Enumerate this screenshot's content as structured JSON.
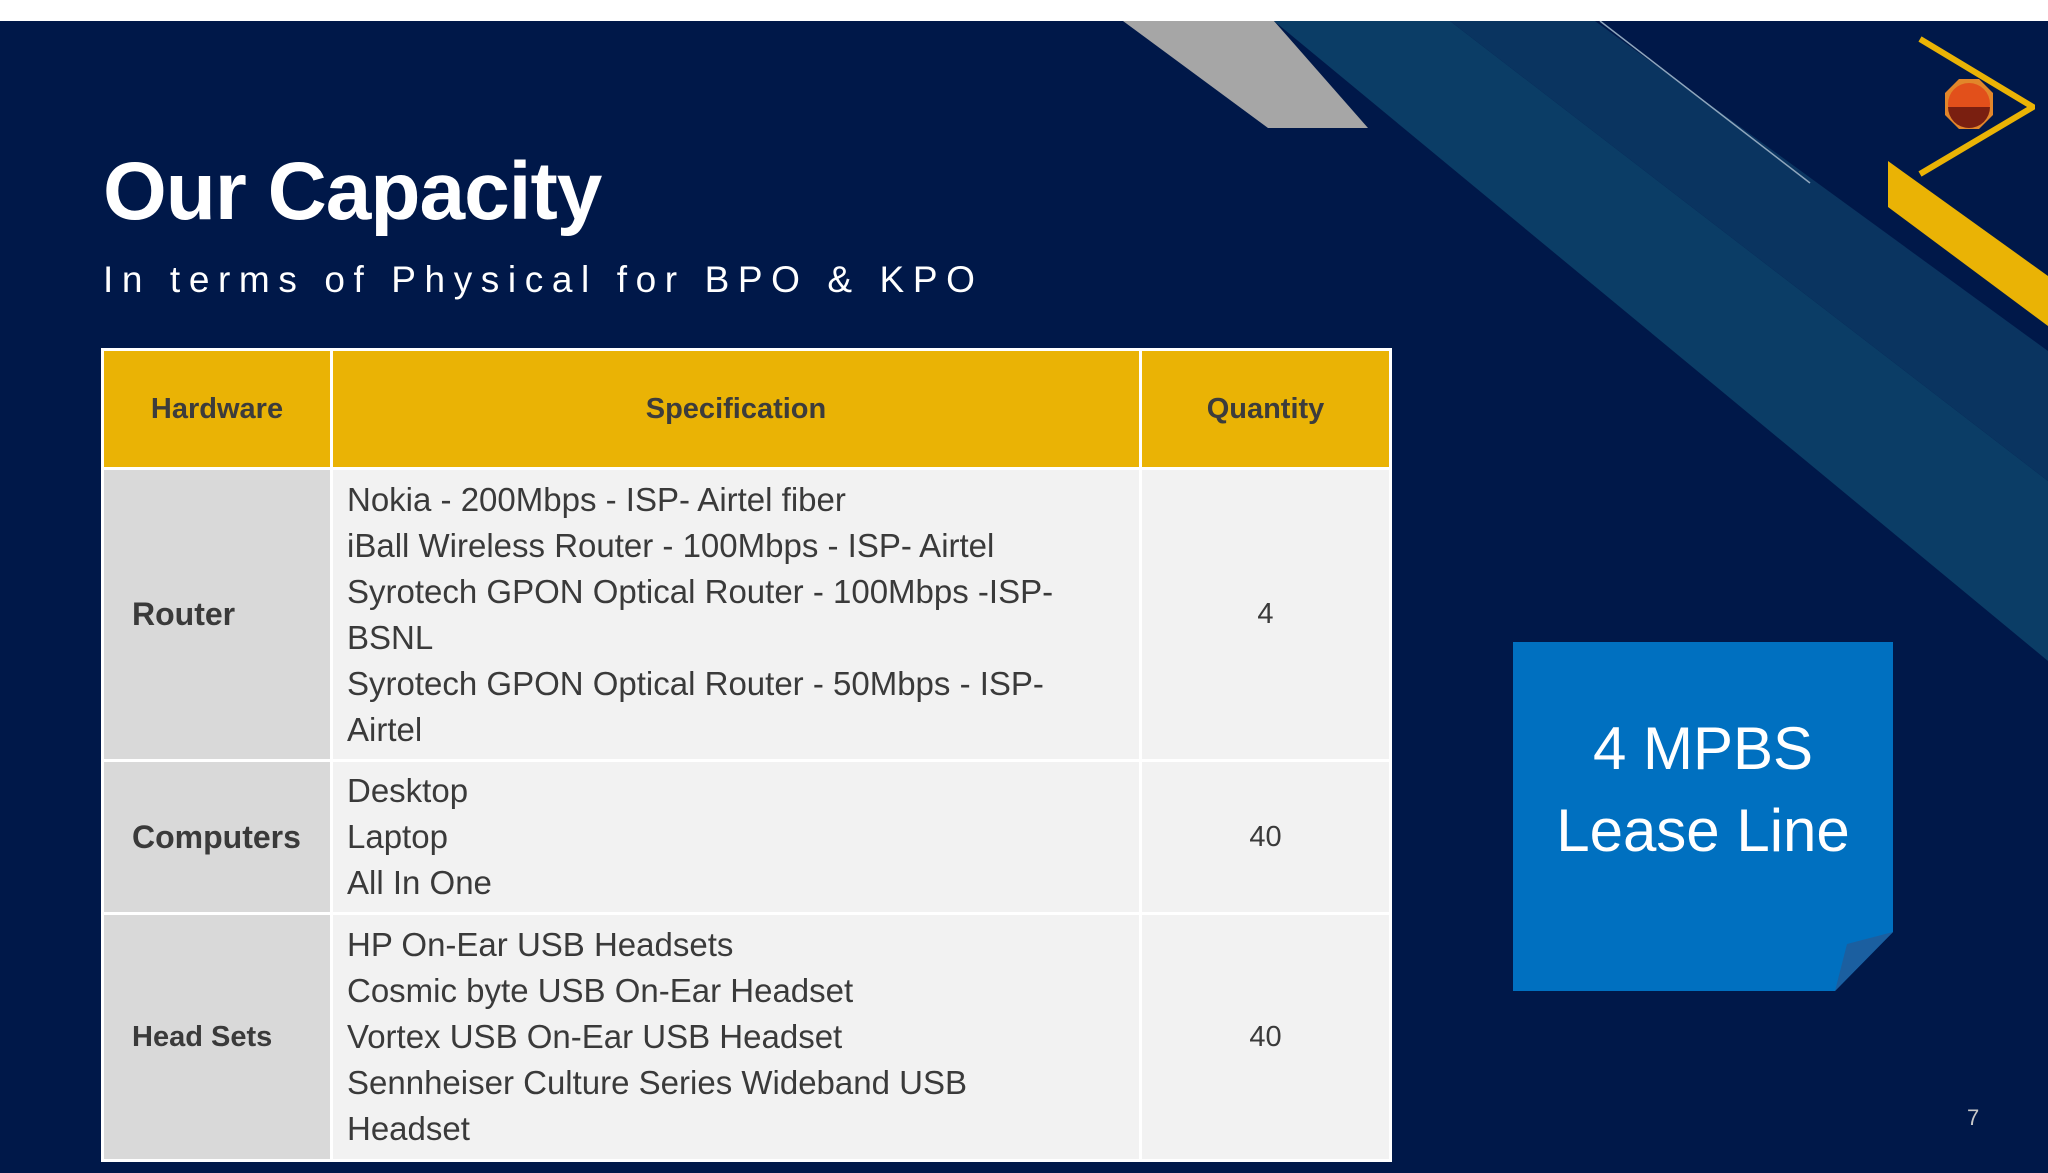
{
  "slide": {
    "title": "Our Capacity",
    "subtitle": "In terms of Physical for BPO & KPO",
    "page_number": "7"
  },
  "table": {
    "headers": [
      "Hardware",
      "Specification",
      "Quantity"
    ],
    "rows": [
      {
        "hardware": "Router",
        "specs": [
          "Nokia - 200Mbps - ISP- Airtel fiber",
          "iBall Wireless Router - 100Mbps - ISP- Airtel",
          "Syrotech GPON Optical Router - 100Mbps -ISP-BSNL",
          "Syrotech GPON Optical Router - 50Mbps - ISP-Airtel"
        ],
        "quantity": "4"
      },
      {
        "hardware": "Computers",
        "specs": [
          "Desktop",
          "Laptop",
          "All In One"
        ],
        "quantity": "40"
      },
      {
        "hardware": "Head Sets",
        "specs": [
          "HP On-Ear USB Headsets",
          "Cosmic byte USB On-Ear Headset",
          "Vortex USB On-Ear USB Headset",
          "Sennheiser Culture Series Wideband USB Headset"
        ],
        "quantity": "40"
      }
    ]
  },
  "note": {
    "line1": "4 MPBS",
    "line2": "Lease Line"
  },
  "colors": {
    "background": "#001849",
    "header_fill": "#eab305",
    "note_fill": "#0070c0",
    "first_column_fill": "#d9d9d9",
    "cell_fill": "#f2f2f2",
    "stripe_teal": "#0b3d66",
    "stripe_gray": "#a6a6a6",
    "accent_gold": "#eab305"
  },
  "icons": {
    "logo": "orange-sun-in-triangle-logo"
  }
}
